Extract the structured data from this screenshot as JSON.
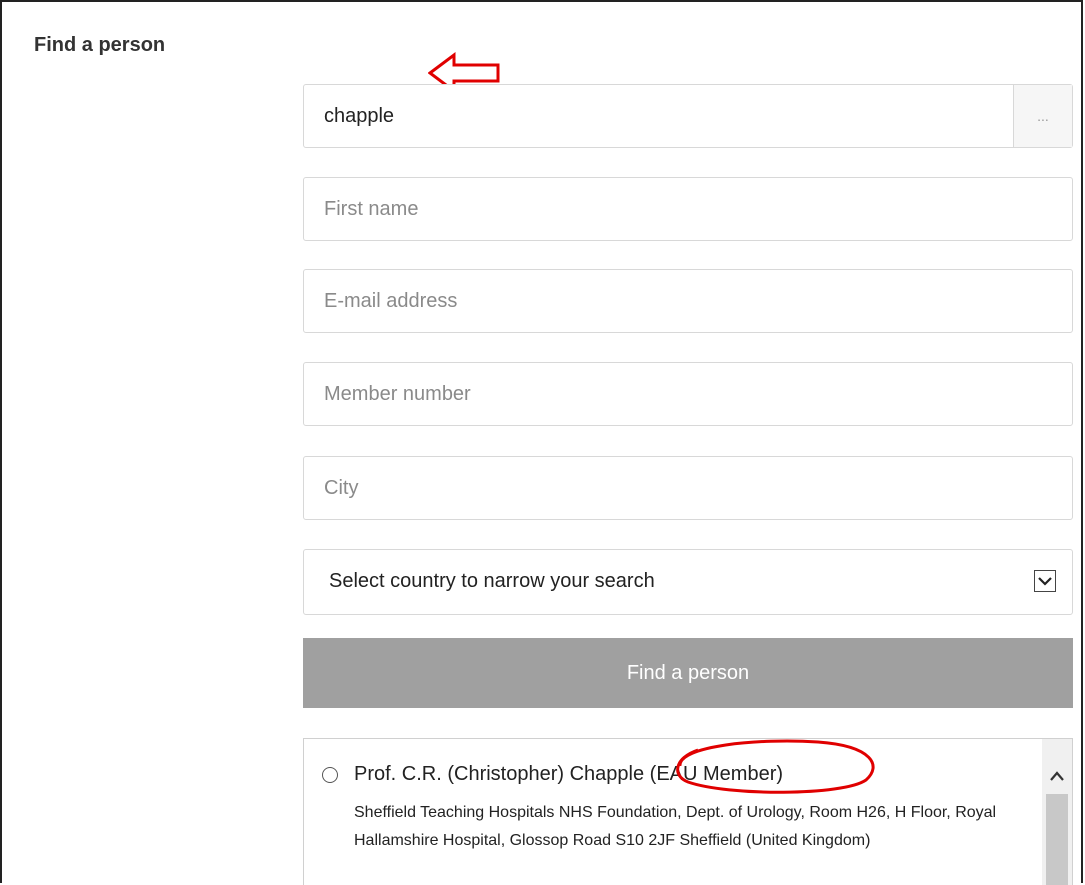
{
  "page": {
    "title": "Find a person"
  },
  "search": {
    "last_name_value": "chapple",
    "more_label": "...",
    "first_name_placeholder": "First name",
    "email_placeholder": "E-mail address",
    "member_number_placeholder": "Member number",
    "city_placeholder": "City",
    "country_selected": "Select country to narrow your search",
    "submit_label": "Find a person"
  },
  "results": [
    {
      "name": "Prof. C.R. (Christopher) Chapple (EAU Member)",
      "address": "Sheffield Teaching Hospitals NHS Foundation, Dept. of Urology, Room H26, H Floor, Royal Hallamshire Hospital, Glossop Road S10 2JF Sheffield (United Kingdom)"
    }
  ],
  "annotation_color": "#e00000",
  "icons": [
    "left-arrow-annotation-icon",
    "chevron-down-icon",
    "chevron-up-icon"
  ]
}
